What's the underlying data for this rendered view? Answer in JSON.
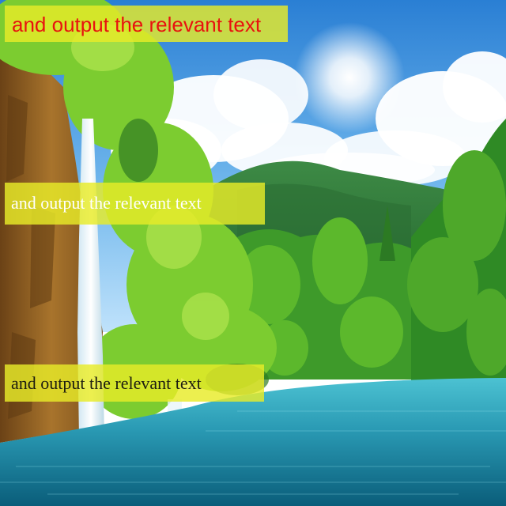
{
  "scene": {
    "description_icons": [
      "waterfall-icon",
      "mountain-icon",
      "sun-icon",
      "cloud-icon",
      "lake-icon"
    ],
    "colors": {
      "sky_top": "#2a7fd4",
      "sky_bottom": "#bfe2fb",
      "cloud": "#ffffff",
      "mountain": "#2f7a3c",
      "foliage_light": "#8cd23a",
      "foliage_dark": "#1f6b22",
      "cliff": "#8a5a1e",
      "water_top": "#3bb0c4",
      "water_bottom": "#0a5d7a",
      "waterfall": "#eaf6ff"
    }
  },
  "captions": {
    "top": {
      "text": "and output the relevant text",
      "color": "#e8120f",
      "bg": "#e8ec28"
    },
    "middle": {
      "text": "and output the relevant text",
      "color": "#ffffff",
      "bg": "#e8ec28"
    },
    "bottom": {
      "text": "and output the relevant text",
      "color": "#1c1c10",
      "bg": "#e8ec28"
    }
  }
}
